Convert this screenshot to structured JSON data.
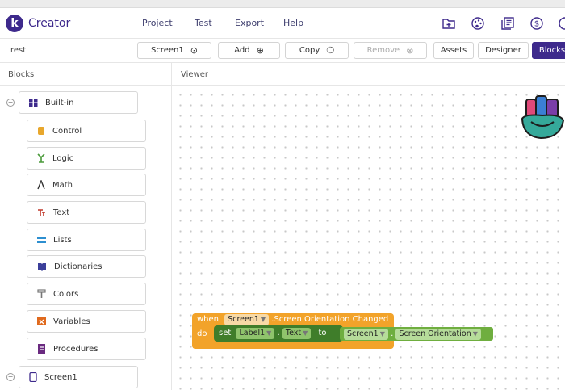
{
  "app": {
    "brand": "Creator",
    "logo_letter": "k"
  },
  "menu": [
    {
      "label": "Project"
    },
    {
      "label": "Test"
    },
    {
      "label": "Export"
    },
    {
      "label": "Help"
    }
  ],
  "header_icons": [
    "folder-add-icon",
    "palette-icon",
    "library-icon",
    "dollar-icon",
    "smiley-icon"
  ],
  "toolbar": {
    "project_name": "rest",
    "screen_select": "Screen1",
    "add_label": "Add",
    "copy_label": "Copy",
    "remove_label": "Remove",
    "assets_label": "Assets",
    "designer_label": "Designer",
    "blocks_label": "Blocks"
  },
  "panels": {
    "blocks_title": "Blocks",
    "viewer_title": "Viewer"
  },
  "tree": {
    "builtin_label": "Built-in",
    "items": [
      {
        "label": "Control",
        "color": "#e8a72c"
      },
      {
        "label": "Logic",
        "color": "#4a9a3a"
      },
      {
        "label": "Math",
        "color": "#333333"
      },
      {
        "label": "Text",
        "color": "#c0392b"
      },
      {
        "label": "Lists",
        "color": "#2d8fd0"
      },
      {
        "label": "Dictionaries",
        "color": "#3b3f9a"
      },
      {
        "label": "Colors",
        "color": "#777777"
      },
      {
        "label": "Variables",
        "color": "#e06a1e"
      },
      {
        "label": "Procedures",
        "color": "#6a2a80"
      }
    ],
    "screen_label": "Screen1"
  },
  "blocks": {
    "when": "when",
    "when_component": "Screen1",
    "event": ".Screen Orientation Changed",
    "do": "do",
    "set": "set",
    "set_component": "Label1",
    "dot": ".",
    "set_property": "Text",
    "to": "to",
    "getter_component": "Screen1",
    "getter_property": "Screen Orientation"
  },
  "colors": {
    "accent": "#3e2a8c",
    "event_block": "#f2a32a",
    "component_block": "#6fae3f",
    "setter_block": "#3f7d2a"
  }
}
